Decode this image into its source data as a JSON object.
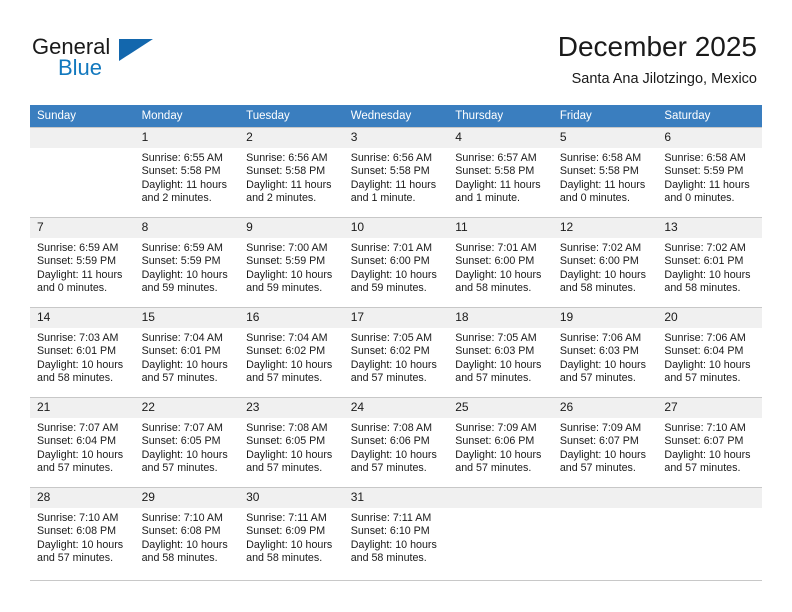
{
  "brand": {
    "word_one": "General",
    "word_two": "Blue",
    "logo_icon": "triangle-flag-icon",
    "color_primary": "#1367ad",
    "color_text": "#1a1a1a"
  },
  "header": {
    "title": "December 2025",
    "subtitle": "Santa Ana Jilotzingo, Mexico"
  },
  "theme": {
    "header_row_bg": "#3a7ebf",
    "daynum_bg": "#f0f0f0",
    "grid_line": "#c8c8c8"
  },
  "weekdays": [
    "Sunday",
    "Monday",
    "Tuesday",
    "Wednesday",
    "Thursday",
    "Friday",
    "Saturday"
  ],
  "weeks": [
    [
      {
        "day": "",
        "sunrise": "",
        "sunset": "",
        "daylight": "",
        "empty": true
      },
      {
        "day": "1",
        "sunrise": "Sunrise: 6:55 AM",
        "sunset": "Sunset: 5:58 PM",
        "daylight": "Daylight: 11 hours and 2 minutes."
      },
      {
        "day": "2",
        "sunrise": "Sunrise: 6:56 AM",
        "sunset": "Sunset: 5:58 PM",
        "daylight": "Daylight: 11 hours and 2 minutes."
      },
      {
        "day": "3",
        "sunrise": "Sunrise: 6:56 AM",
        "sunset": "Sunset: 5:58 PM",
        "daylight": "Daylight: 11 hours and 1 minute."
      },
      {
        "day": "4",
        "sunrise": "Sunrise: 6:57 AM",
        "sunset": "Sunset: 5:58 PM",
        "daylight": "Daylight: 11 hours and 1 minute."
      },
      {
        "day": "5",
        "sunrise": "Sunrise: 6:58 AM",
        "sunset": "Sunset: 5:58 PM",
        "daylight": "Daylight: 11 hours and 0 minutes."
      },
      {
        "day": "6",
        "sunrise": "Sunrise: 6:58 AM",
        "sunset": "Sunset: 5:59 PM",
        "daylight": "Daylight: 11 hours and 0 minutes."
      }
    ],
    [
      {
        "day": "7",
        "sunrise": "Sunrise: 6:59 AM",
        "sunset": "Sunset: 5:59 PM",
        "daylight": "Daylight: 11 hours and 0 minutes."
      },
      {
        "day": "8",
        "sunrise": "Sunrise: 6:59 AM",
        "sunset": "Sunset: 5:59 PM",
        "daylight": "Daylight: 10 hours and 59 minutes."
      },
      {
        "day": "9",
        "sunrise": "Sunrise: 7:00 AM",
        "sunset": "Sunset: 5:59 PM",
        "daylight": "Daylight: 10 hours and 59 minutes."
      },
      {
        "day": "10",
        "sunrise": "Sunrise: 7:01 AM",
        "sunset": "Sunset: 6:00 PM",
        "daylight": "Daylight: 10 hours and 59 minutes."
      },
      {
        "day": "11",
        "sunrise": "Sunrise: 7:01 AM",
        "sunset": "Sunset: 6:00 PM",
        "daylight": "Daylight: 10 hours and 58 minutes."
      },
      {
        "day": "12",
        "sunrise": "Sunrise: 7:02 AM",
        "sunset": "Sunset: 6:00 PM",
        "daylight": "Daylight: 10 hours and 58 minutes."
      },
      {
        "day": "13",
        "sunrise": "Sunrise: 7:02 AM",
        "sunset": "Sunset: 6:01 PM",
        "daylight": "Daylight: 10 hours and 58 minutes."
      }
    ],
    [
      {
        "day": "14",
        "sunrise": "Sunrise: 7:03 AM",
        "sunset": "Sunset: 6:01 PM",
        "daylight": "Daylight: 10 hours and 58 minutes."
      },
      {
        "day": "15",
        "sunrise": "Sunrise: 7:04 AM",
        "sunset": "Sunset: 6:01 PM",
        "daylight": "Daylight: 10 hours and 57 minutes."
      },
      {
        "day": "16",
        "sunrise": "Sunrise: 7:04 AM",
        "sunset": "Sunset: 6:02 PM",
        "daylight": "Daylight: 10 hours and 57 minutes."
      },
      {
        "day": "17",
        "sunrise": "Sunrise: 7:05 AM",
        "sunset": "Sunset: 6:02 PM",
        "daylight": "Daylight: 10 hours and 57 minutes."
      },
      {
        "day": "18",
        "sunrise": "Sunrise: 7:05 AM",
        "sunset": "Sunset: 6:03 PM",
        "daylight": "Daylight: 10 hours and 57 minutes."
      },
      {
        "day": "19",
        "sunrise": "Sunrise: 7:06 AM",
        "sunset": "Sunset: 6:03 PM",
        "daylight": "Daylight: 10 hours and 57 minutes."
      },
      {
        "day": "20",
        "sunrise": "Sunrise: 7:06 AM",
        "sunset": "Sunset: 6:04 PM",
        "daylight": "Daylight: 10 hours and 57 minutes."
      }
    ],
    [
      {
        "day": "21",
        "sunrise": "Sunrise: 7:07 AM",
        "sunset": "Sunset: 6:04 PM",
        "daylight": "Daylight: 10 hours and 57 minutes."
      },
      {
        "day": "22",
        "sunrise": "Sunrise: 7:07 AM",
        "sunset": "Sunset: 6:05 PM",
        "daylight": "Daylight: 10 hours and 57 minutes."
      },
      {
        "day": "23",
        "sunrise": "Sunrise: 7:08 AM",
        "sunset": "Sunset: 6:05 PM",
        "daylight": "Daylight: 10 hours and 57 minutes."
      },
      {
        "day": "24",
        "sunrise": "Sunrise: 7:08 AM",
        "sunset": "Sunset: 6:06 PM",
        "daylight": "Daylight: 10 hours and 57 minutes."
      },
      {
        "day": "25",
        "sunrise": "Sunrise: 7:09 AM",
        "sunset": "Sunset: 6:06 PM",
        "daylight": "Daylight: 10 hours and 57 minutes."
      },
      {
        "day": "26",
        "sunrise": "Sunrise: 7:09 AM",
        "sunset": "Sunset: 6:07 PM",
        "daylight": "Daylight: 10 hours and 57 minutes."
      },
      {
        "day": "27",
        "sunrise": "Sunrise: 7:10 AM",
        "sunset": "Sunset: 6:07 PM",
        "daylight": "Daylight: 10 hours and 57 minutes."
      }
    ],
    [
      {
        "day": "28",
        "sunrise": "Sunrise: 7:10 AM",
        "sunset": "Sunset: 6:08 PM",
        "daylight": "Daylight: 10 hours and 57 minutes."
      },
      {
        "day": "29",
        "sunrise": "Sunrise: 7:10 AM",
        "sunset": "Sunset: 6:08 PM",
        "daylight": "Daylight: 10 hours and 58 minutes."
      },
      {
        "day": "30",
        "sunrise": "Sunrise: 7:11 AM",
        "sunset": "Sunset: 6:09 PM",
        "daylight": "Daylight: 10 hours and 58 minutes."
      },
      {
        "day": "31",
        "sunrise": "Sunrise: 7:11 AM",
        "sunset": "Sunset: 6:10 PM",
        "daylight": "Daylight: 10 hours and 58 minutes."
      },
      {
        "day": "",
        "sunrise": "",
        "sunset": "",
        "daylight": "",
        "empty": true
      },
      {
        "day": "",
        "sunrise": "",
        "sunset": "",
        "daylight": "",
        "empty": true
      },
      {
        "day": "",
        "sunrise": "",
        "sunset": "",
        "daylight": "",
        "empty": true
      }
    ]
  ]
}
